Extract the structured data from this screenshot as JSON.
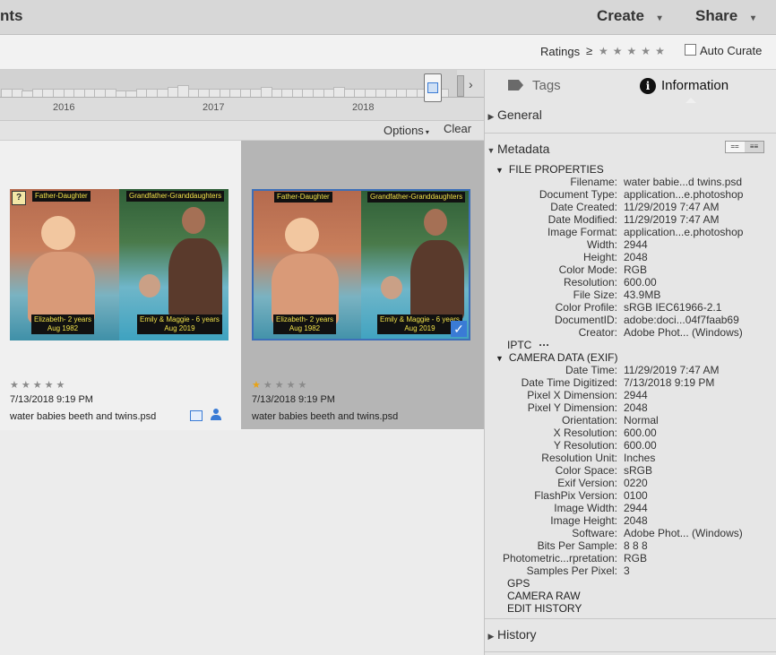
{
  "header": {
    "title_fragment": "nts",
    "create_label": "Create",
    "share_label": "Share",
    "caret_icon": "chevron-down-icon"
  },
  "rating_filter": {
    "label": "Ratings",
    "operator": "≥",
    "stars": 0,
    "auto_curate_label": "Auto Curate",
    "auto_curate_checked": false
  },
  "timeline": {
    "years": [
      "2016",
      "2017",
      "2018"
    ]
  },
  "options_bar": {
    "options_label": "Options",
    "clear_label": "Clear"
  },
  "grid": {
    "items": [
      {
        "captions": {
          "top_left": "Father-Daughter",
          "top_right": "Grandfather-Granddaughters",
          "bottom_left_1": "Elizabeth- 2 years",
          "bottom_left_2": "Aug 1982",
          "bottom_right_1": "Emily & Maggie - 6 years",
          "bottom_right_2": "Aug 2019"
        },
        "rating": 0,
        "date": "7/13/2018 9:19 PM",
        "filename": "water babies beeth and twins.psd",
        "selected": false
      },
      {
        "captions": {
          "top_left": "Father-Daughter",
          "top_right": "Grandfather-Granddaughters",
          "bottom_left_1": "Elizabeth- 2 years",
          "bottom_left_2": "Aug 1982",
          "bottom_right_1": "Emily & Maggie - 6 years",
          "bottom_right_2": "Aug 2019"
        },
        "rating": 1,
        "date": "7/13/2018 9:19 PM",
        "filename": "water babies beeth and twins.psd",
        "selected": true
      }
    ]
  },
  "panel": {
    "tabs": [
      {
        "label": "Tags",
        "icon": "tag-icon",
        "active": false
      },
      {
        "label": "Information",
        "icon": "info-icon",
        "active": true
      }
    ],
    "sections": {
      "general": "General",
      "metadata": "Metadata",
      "history": "History"
    },
    "file_properties_title": "FILE PROPERTIES",
    "file_properties": [
      {
        "key": "Filename:",
        "value": "water babie...d twins.psd"
      },
      {
        "key": "Document Type:",
        "value": "application...e.photoshop"
      },
      {
        "key": "Date Created:",
        "value": "11/29/2019 7:47 AM"
      },
      {
        "key": "Date Modified:",
        "value": "11/29/2019 7:47 AM"
      },
      {
        "key": "Image Format:",
        "value": "application...e.photoshop"
      },
      {
        "key": "Width:",
        "value": "2944"
      },
      {
        "key": "Height:",
        "value": "2048"
      },
      {
        "key": "Color Mode:",
        "value": "RGB"
      },
      {
        "key": "Resolution:",
        "value": "600.00"
      },
      {
        "key": "File Size:",
        "value": "43.9MB"
      },
      {
        "key": "Color Profile:",
        "value": "sRGB IEC61966-2.1"
      },
      {
        "key": "DocumentID:",
        "value": "adobe:doci...04f7faab69"
      },
      {
        "key": "Creator:",
        "value": "Adobe Phot... (Windows)"
      }
    ],
    "iptc_label": "IPTC",
    "iptc_more": "···",
    "camera_title": "CAMERA DATA (EXIF)",
    "camera_data": [
      {
        "key": "Date Time:",
        "value": "11/29/2019 7:47 AM"
      },
      {
        "key": "Date Time Digitized:",
        "value": "7/13/2018 9:19 PM"
      },
      {
        "key": "Pixel X Dimension:",
        "value": "2944"
      },
      {
        "key": "Pixel Y Dimension:",
        "value": "2048"
      },
      {
        "key": "Orientation:",
        "value": "Normal"
      },
      {
        "key": "X Resolution:",
        "value": "600.00"
      },
      {
        "key": "Y Resolution:",
        "value": "600.00"
      },
      {
        "key": "Resolution Unit:",
        "value": "Inches"
      },
      {
        "key": "Color Space:",
        "value": "sRGB"
      },
      {
        "key": "Exif Version:",
        "value": "0220"
      },
      {
        "key": "FlashPix Version:",
        "value": "0100"
      },
      {
        "key": "Image Width:",
        "value": "2944"
      },
      {
        "key": "Image Height:",
        "value": "2048"
      },
      {
        "key": "Software:",
        "value": "Adobe Phot... (Windows)"
      },
      {
        "key": "Bits Per Sample:",
        "value": "8 8 8"
      },
      {
        "key": "Photometric...rpretation:",
        "value": "RGB"
      },
      {
        "key": "Samples Per Pixel:",
        "value": "3"
      }
    ],
    "extra_sections": [
      "GPS",
      "CAMERA RAW",
      "EDIT HISTORY"
    ]
  },
  "colors": {
    "selection_border": "#3d6fb8",
    "star_filled": "#e8a317",
    "accent_blue": "#3a7bd5"
  }
}
